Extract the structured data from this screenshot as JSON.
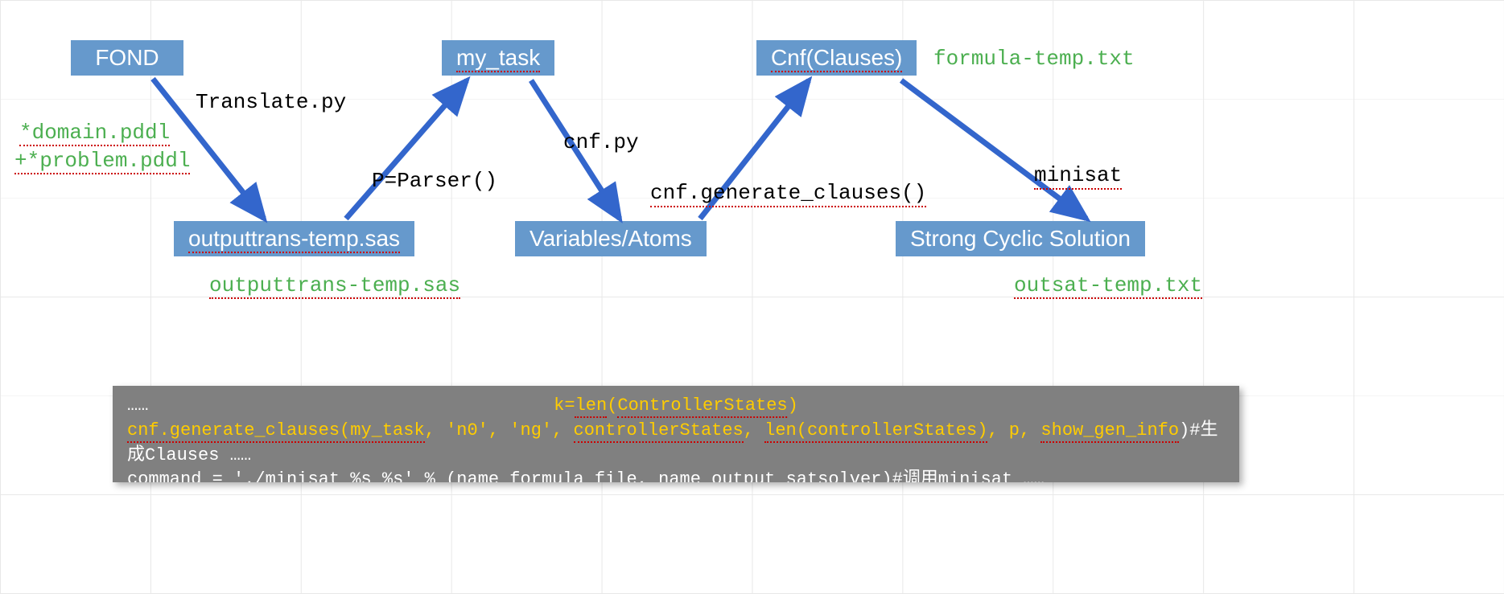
{
  "nodes": {
    "fond": "FOND",
    "output_sas": "outputtrans-temp.sas",
    "my_task": "my_task",
    "vars": "Variables/Atoms",
    "cnf": "Cnf(Clauses)",
    "solution": "Strong Cyclic Solution"
  },
  "edges": {
    "translate": "Translate.py",
    "parser": "P=Parser()",
    "cnfpy": "cnf.py",
    "gen": "cnf.generate_clauses()",
    "minisat": "minisat"
  },
  "labels": {
    "in1": "*domain.pddl",
    "in2": "+*problem.pddl",
    "out_sas": "outputtrans-temp.sas",
    "formula": "formula-temp.txt",
    "outsat": "outsat-temp.txt"
  },
  "code": {
    "l1_pre": "……",
    "l1_center": "k=len(ControllerStates)",
    "l2a": "cnf.generate_clauses(my_task",
    "l2b": ", 'n0', 'ng', ",
    "l2c": "controllerStates",
    "l2d": ", ",
    "l2e": "len(controllerStates)",
    "l2f": ",  p, ",
    "l2g": "show_gen_info",
    "l2h": ")#生成Clauses ……",
    "l3a": "command = './",
    "l3b": "minisat",
    "l3c": " %s %s' % (",
    "l3d": "name_formula_file",
    "l3e": ", ",
    "l3f": "name_output_satsolver",
    "l3g": ")#调用minisat ……"
  }
}
